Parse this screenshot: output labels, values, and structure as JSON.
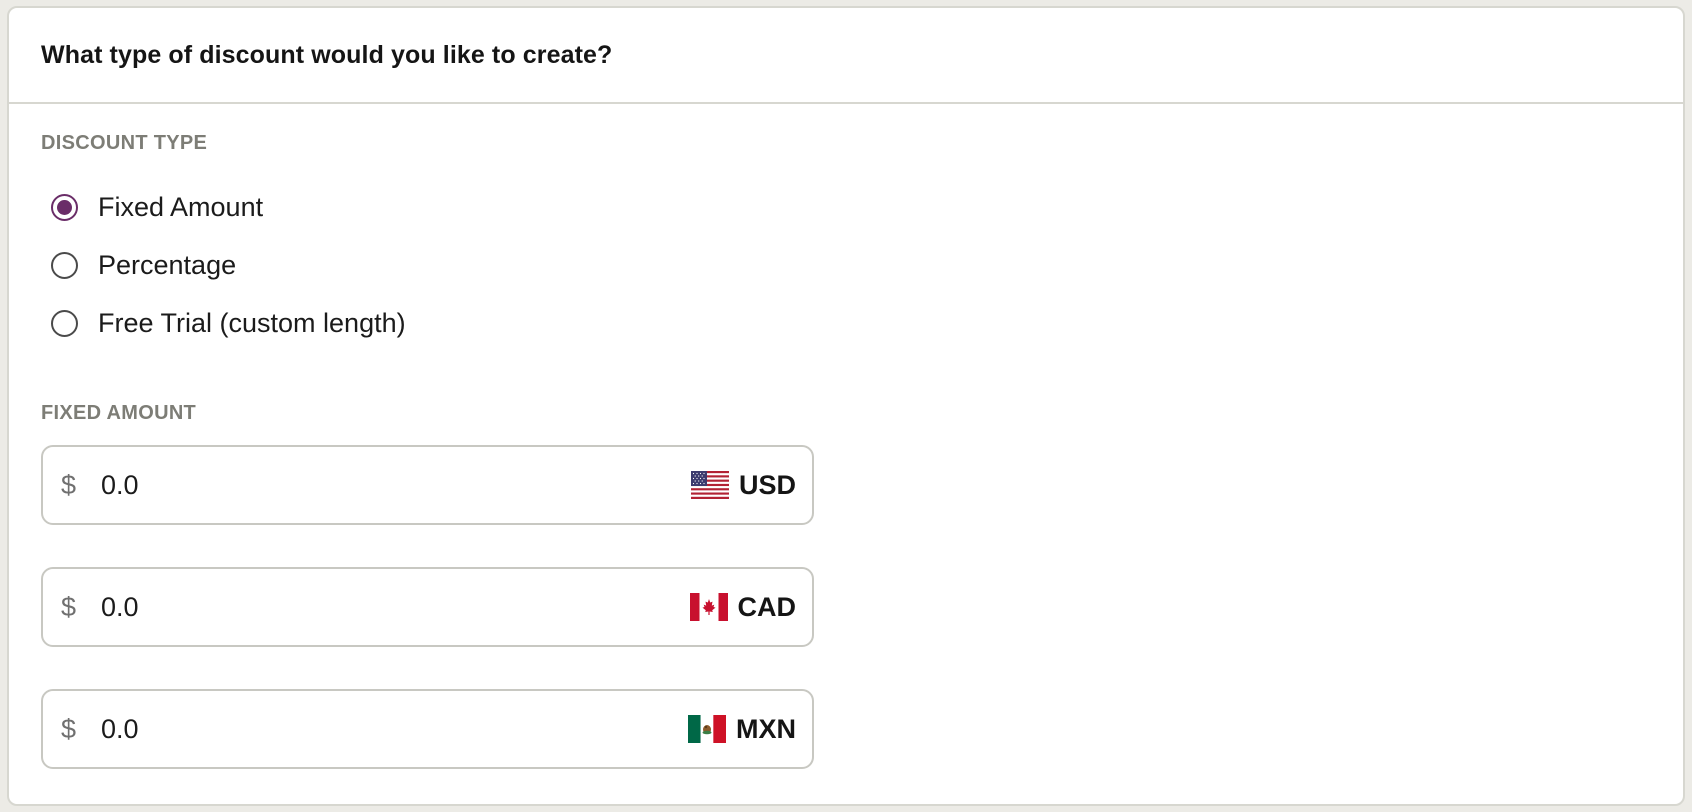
{
  "header": {
    "title": "What type of discount would you like to create?"
  },
  "discount_type": {
    "label": "DISCOUNT TYPE",
    "options": [
      {
        "label": "Fixed Amount",
        "selected": true
      },
      {
        "label": "Percentage",
        "selected": false
      },
      {
        "label": "Free Trial (custom length)",
        "selected": false
      }
    ]
  },
  "fixed_amount": {
    "label": "FIXED AMOUNT",
    "fields": [
      {
        "symbol": "$",
        "value": "0.0",
        "currency": "USD",
        "flag_icon": "us-flag-icon"
      },
      {
        "symbol": "$",
        "value": "0.0",
        "currency": "CAD",
        "flag_icon": "canada-flag-icon"
      },
      {
        "symbol": "$",
        "value": "0.0",
        "currency": "MXN",
        "flag_icon": "mexico-flag-icon"
      }
    ]
  },
  "colors": {
    "accent": "#6a2d68",
    "label_gray": "#7d7d76",
    "border": "#d7d7d0"
  }
}
